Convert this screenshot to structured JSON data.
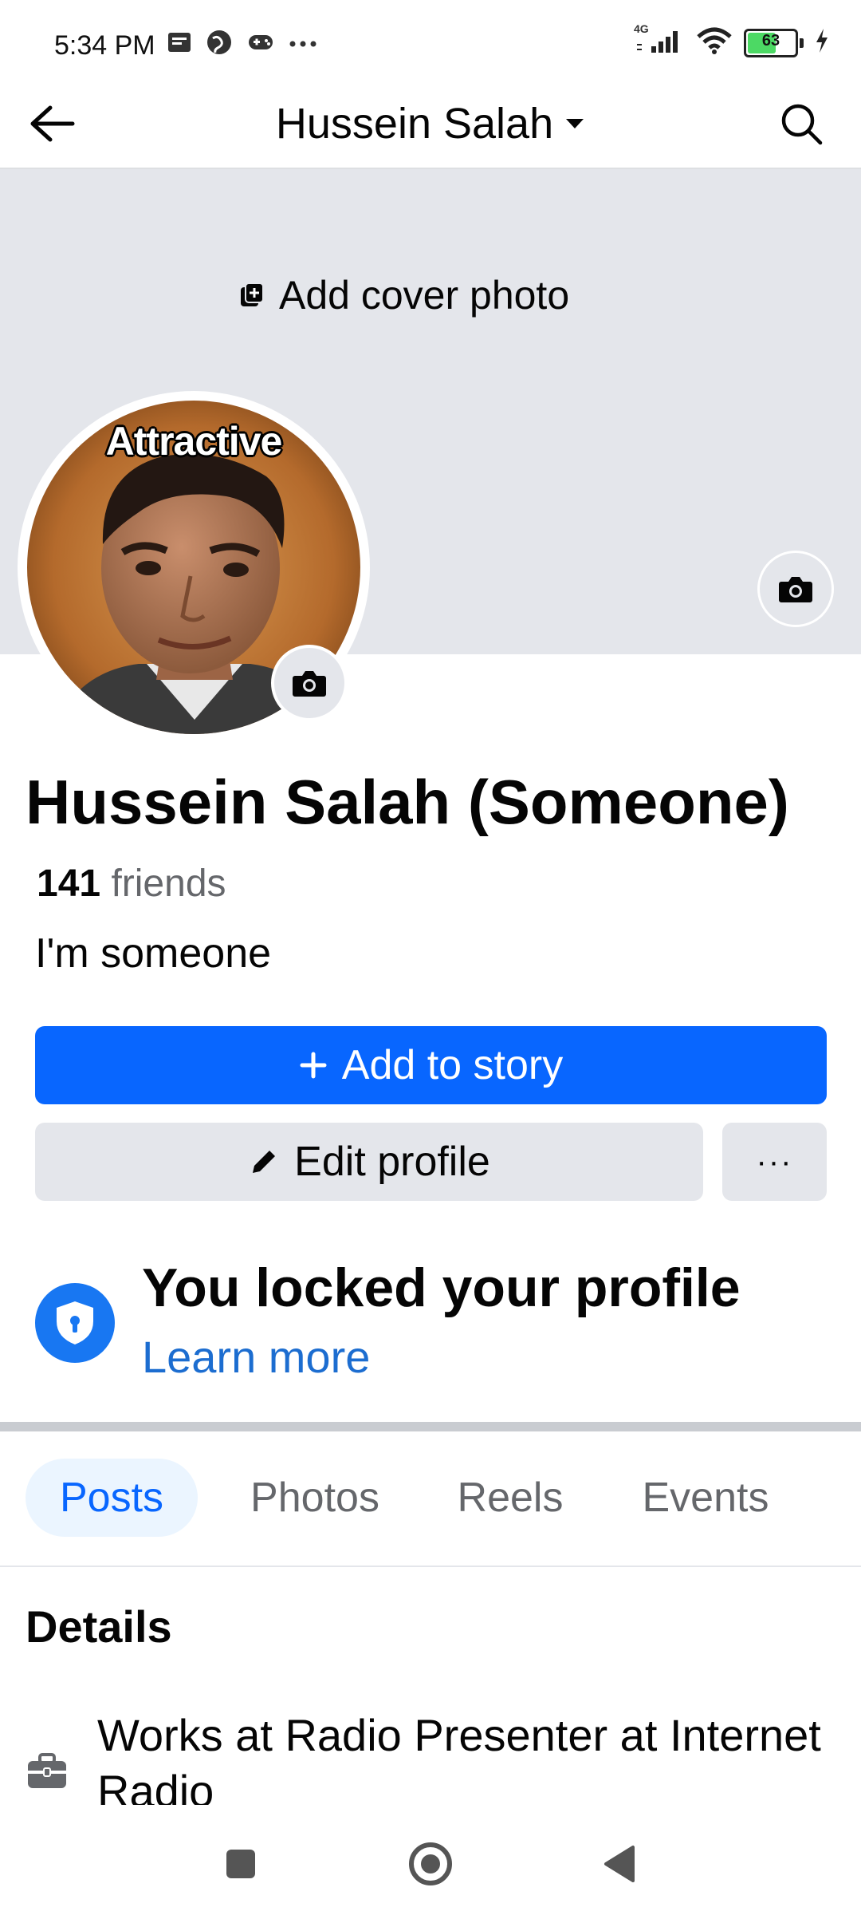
{
  "status_bar": {
    "time": "5:34 PM",
    "network": "4G",
    "battery": "63",
    "battery_fraction": 0.63
  },
  "header": {
    "title": "Hussein Salah"
  },
  "cover": {
    "add_label": "Add cover photo"
  },
  "avatar": {
    "caption": "Attractive"
  },
  "profile": {
    "name": "Hussein Salah (Someone)",
    "friends_count": "141",
    "friends_label": "friends",
    "bio": "I'm someone"
  },
  "actions": {
    "add_story": "Add to story",
    "edit_profile": "Edit profile",
    "more": "···"
  },
  "locked": {
    "title": "You locked your profile",
    "link": "Learn more"
  },
  "tabs": [
    {
      "label": "Posts",
      "active": true
    },
    {
      "label": "Photos",
      "active": false
    },
    {
      "label": "Reels",
      "active": false
    },
    {
      "label": "Events",
      "active": false
    }
  ],
  "details": {
    "title": "Details",
    "work": "Works at Radio Presenter at Internet Radio"
  },
  "colors": {
    "primary": "#0866ff",
    "link": "#1c6dd0",
    "cover": "#e4e6eb",
    "lock_blue": "#1877f2"
  }
}
